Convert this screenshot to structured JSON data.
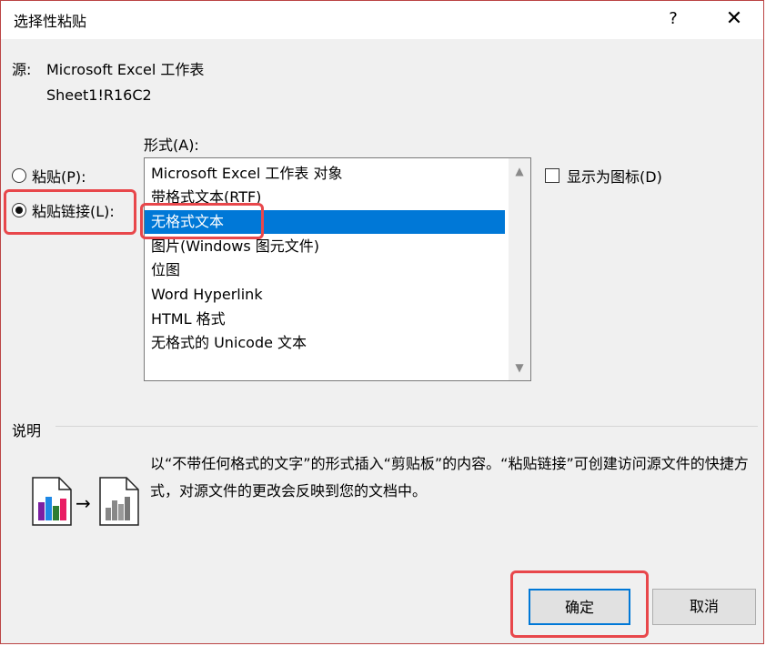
{
  "dialog": {
    "title": "选择性粘贴",
    "help_label": "?",
    "close_label": "✕"
  },
  "source": {
    "label": "源:",
    "line1": "Microsoft Excel 工作表",
    "line2": "Sheet1!R16C2"
  },
  "format": {
    "label": "形式(A):",
    "items": [
      "Microsoft Excel 工作表 对象",
      "带格式文本(RTF)",
      "无格式文本",
      "图片(Windows 图元文件)",
      "位图",
      "Word Hyperlink",
      "HTML 格式",
      "无格式的 Unicode 文本"
    ],
    "selected_index": 2
  },
  "options": {
    "paste_label": "粘贴(P):",
    "paste_link_label": "粘贴链接(L):",
    "selected": "paste_link",
    "display_as_icon_label": "显示为图标(D)",
    "display_as_icon_checked": false
  },
  "description": {
    "label": "说明",
    "text": "以“不带任何格式的文字”的形式插入“剪贴板”的内容。“粘贴链接”可创建访问源文件的快捷方式，对源文件的更改会反映到您的文档中。"
  },
  "buttons": {
    "ok": "确定",
    "cancel": "取消"
  },
  "colors": {
    "selection": "#0078d7",
    "highlight": "#e8474b"
  },
  "icons": {
    "scroll_up": "▲",
    "scroll_down": "▼",
    "arrow": "→"
  }
}
